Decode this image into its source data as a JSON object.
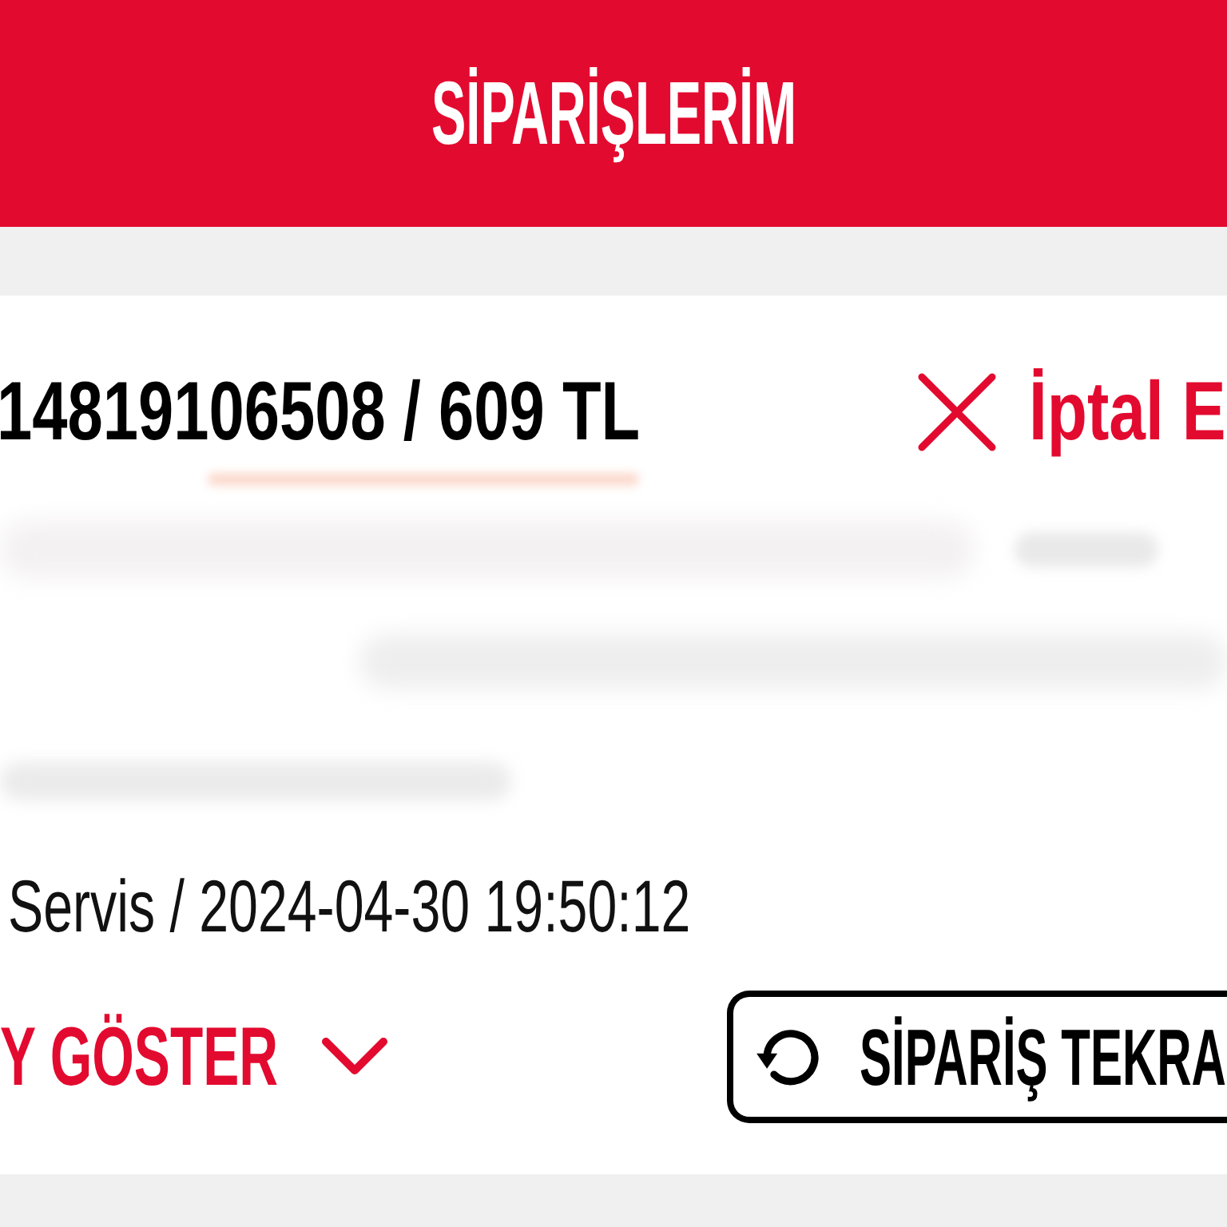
{
  "header": {
    "title": "SİPARİŞLERİM"
  },
  "order": {
    "summary": "14819106508 / 609 TL",
    "cancel_link": "İptal E",
    "delivery_info": "Servis / 2024-04-30 19:50:12",
    "details_toggle": {
      "label": "Y GÖSTER",
      "expanded": false
    },
    "reorder_button": "SİPARİŞ TEKRA"
  }
}
